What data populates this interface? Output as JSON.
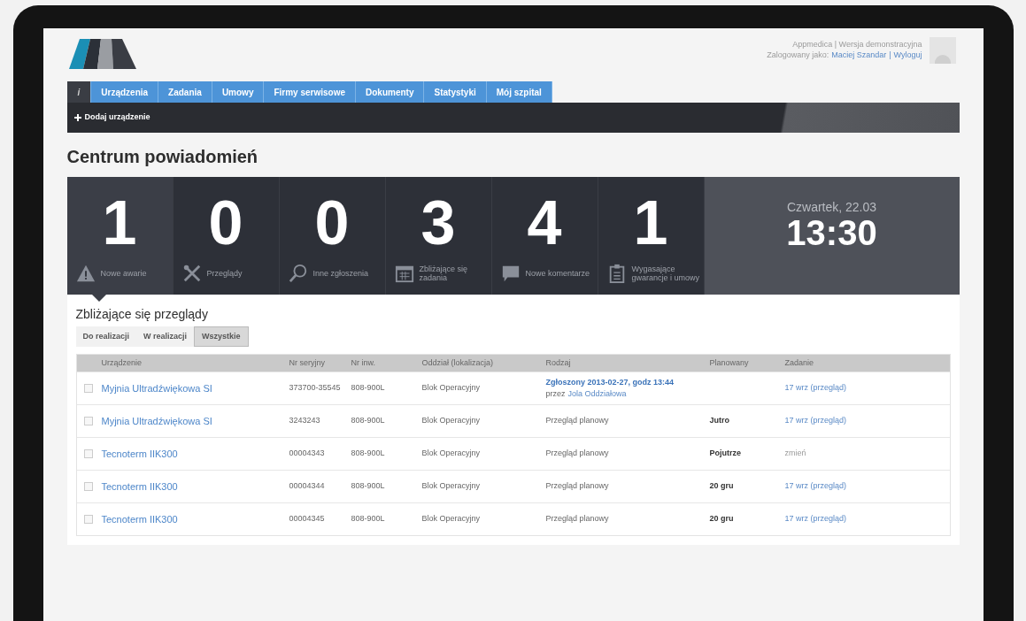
{
  "header": {
    "app_line": "Appmedica | Wersja demonstracyjna",
    "logged_label": "Zalogowany jako:",
    "user": "Maciej Szandar",
    "separator": "|",
    "logout": "Wyloguj"
  },
  "nav": {
    "tabs": [
      {
        "label": "i",
        "kind": "info",
        "selected": true
      },
      {
        "label": "Urządzenia",
        "kind": "text",
        "selected": false
      },
      {
        "label": "Zadania",
        "kind": "text",
        "selected": false
      },
      {
        "label": "Umowy",
        "kind": "text",
        "selected": false
      },
      {
        "label": "Firmy serwisowe",
        "kind": "text",
        "selected": false
      },
      {
        "label": "Dokumenty",
        "kind": "text",
        "selected": false
      },
      {
        "label": "Statystyki",
        "kind": "text",
        "selected": false
      },
      {
        "label": "Mój szpital",
        "kind": "text",
        "selected": false
      }
    ],
    "action": "Dodaj urządzenie"
  },
  "page_title": "Centrum powiadomień",
  "stats": [
    {
      "value": "1",
      "label": "Nowe awarie",
      "selected": true
    },
    {
      "value": "0",
      "label": "Przeglądy",
      "selected": false
    },
    {
      "value": "0",
      "label": "Inne zgłoszenia",
      "selected": false
    },
    {
      "value": "3",
      "label": "Zbliżające się zadania",
      "selected": false
    },
    {
      "value": "4",
      "label": "Nowe komentarze",
      "selected": false
    },
    {
      "value": "1",
      "label": "Wygasające gwarancje i umowy",
      "selected": false
    }
  ],
  "clock": {
    "date": "Czwartek, 22.03",
    "time": "13:30"
  },
  "panel": {
    "title": "Zbliżające się przeglądy",
    "filters": [
      {
        "label": "Do realizacji",
        "selected": false
      },
      {
        "label": "W realizacji",
        "selected": false
      },
      {
        "label": "Wszystkie",
        "selected": true
      }
    ],
    "table": {
      "columns": [
        "Urządzenie",
        "Nr seryjny",
        "Nr inw.",
        "Oddział (lokalizacja)",
        "Rodzaj",
        "Planowany",
        "Zadanie"
      ],
      "rows": [
        {
          "checked": false,
          "device": "Myjnia Ultradźwiękowa SI",
          "serial": "373700-35545",
          "inv": "808-900L",
          "dept": "Blok Operacyjny",
          "type": {
            "kind": "report",
            "title": "Zgłoszony 2013-02-27, godz 13:44",
            "by_label": "przez",
            "by": "Jola Oddziałowa"
          },
          "planned": "",
          "task": {
            "text": "17 wrz (przegląd)",
            "disabled": false
          }
        },
        {
          "checked": false,
          "device": "Myjnia Ultradźwiękowa SI",
          "serial": "3243243",
          "inv": "808-900L",
          "dept": "Blok Operacyjny",
          "type": {
            "kind": "plain",
            "title": "Przegląd planowy"
          },
          "planned": "Jutro",
          "task": {
            "text": "17 wrz (przegląd)",
            "disabled": false
          }
        },
        {
          "checked": false,
          "device": "Tecnoterm IIK300",
          "serial": "00004343",
          "inv": "808-900L",
          "dept": "Blok Operacyjny",
          "type": {
            "kind": "plain",
            "title": "Przegląd planowy"
          },
          "planned": "Pojutrze",
          "task": {
            "text": "zmień",
            "disabled": true
          }
        },
        {
          "checked": false,
          "device": "Tecnoterm IIK300",
          "serial": "00004344",
          "inv": "808-900L",
          "dept": "Blok Operacyjny",
          "type": {
            "kind": "plain",
            "title": "Przegląd planowy"
          },
          "planned": "20 gru",
          "task": {
            "text": "17 wrz (przegląd)",
            "disabled": false
          }
        },
        {
          "checked": false,
          "device": "Tecnoterm IIK300",
          "serial": "00004345",
          "inv": "808-900L",
          "dept": "Blok Operacyjny",
          "type": {
            "kind": "plain",
            "title": "Przegląd planowy"
          },
          "planned": "20 gru",
          "task": {
            "text": "17 wrz (przegląd)",
            "disabled": false
          }
        }
      ]
    }
  }
}
